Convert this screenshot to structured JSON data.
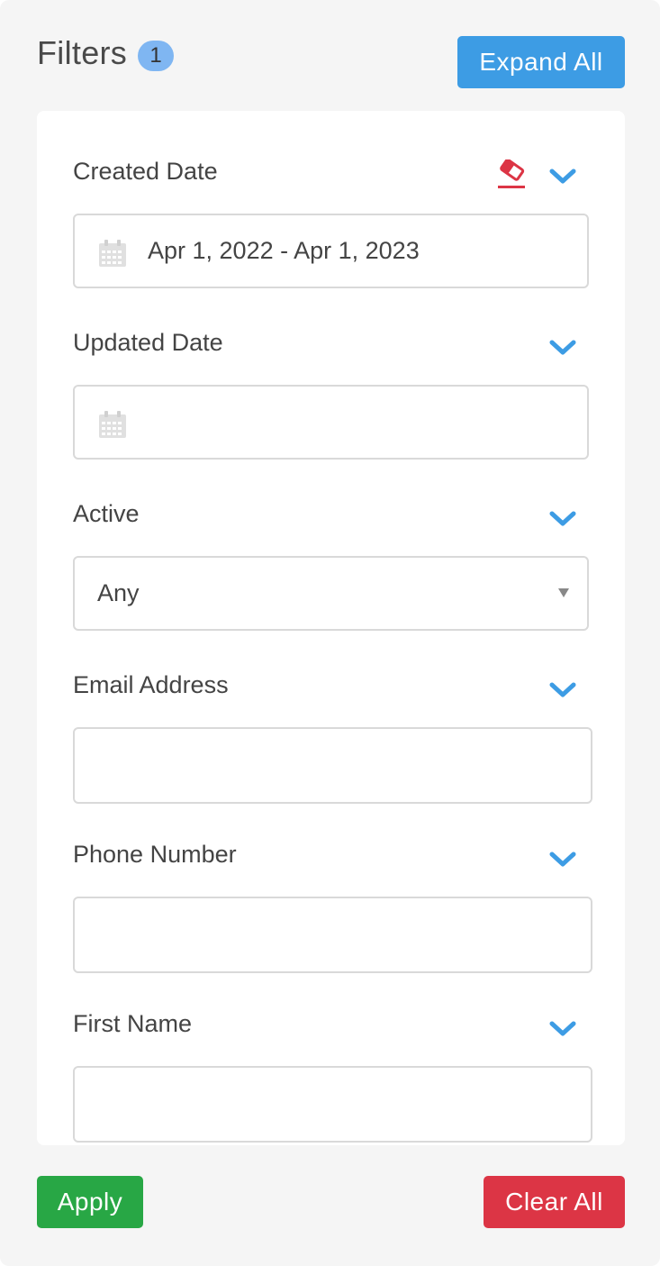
{
  "header": {
    "title": "Filters",
    "badge_count": "1",
    "expand_all_label": "Expand All"
  },
  "filters": [
    {
      "label": "Created Date",
      "type": "date-range",
      "value": "Apr 1, 2022 - Apr 1, 2023",
      "has_clear_icon": true
    },
    {
      "label": "Updated Date",
      "type": "date-range",
      "value": ""
    },
    {
      "label": "Active",
      "type": "select",
      "value": "Any"
    },
    {
      "label": "Email Address",
      "type": "text",
      "value": ""
    },
    {
      "label": "Phone Number",
      "type": "text",
      "value": ""
    },
    {
      "label": "First Name",
      "type": "text",
      "value": ""
    }
  ],
  "footer": {
    "apply_label": "Apply",
    "clear_all_label": "Clear All"
  },
  "icons": {
    "chevron": "chevron-down-icon",
    "eraser": "eraser-icon",
    "calendar": "calendar-icon"
  },
  "colors": {
    "primary": "#3d9ce4",
    "success": "#28a745",
    "danger": "#dc3545",
    "badge": "#7fb6f2",
    "chevron": "#3d9ce4",
    "eraser": "#dc3545"
  }
}
